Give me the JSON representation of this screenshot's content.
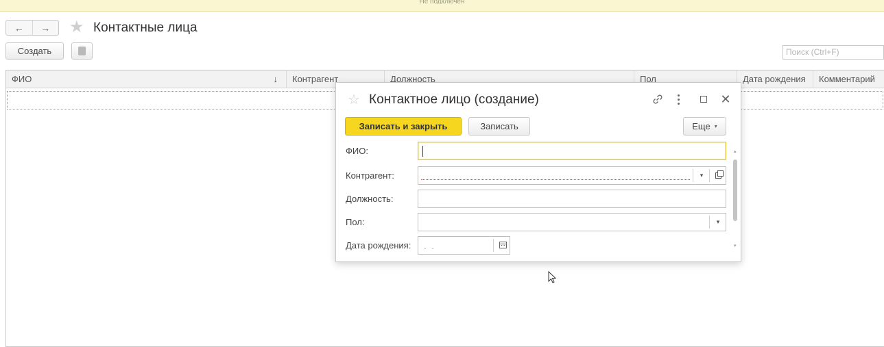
{
  "topbar": {
    "text": "Не подключен"
  },
  "nav": {
    "back_icon": "←",
    "forward_icon": "→"
  },
  "page": {
    "title": "Контактные лица",
    "favorite_icon": "★"
  },
  "toolbar": {
    "create_label": "Создать",
    "print_icon": "print-icon"
  },
  "search": {
    "placeholder": "Поиск (Ctrl+F)"
  },
  "table": {
    "columns": [
      "ФИО",
      "Контрагент",
      "Должность",
      "Пол",
      "Дата рождения",
      "Комментарий"
    ],
    "sort_indicator": "↓"
  },
  "dialog": {
    "title": "Контактное лицо (создание)",
    "star_icon": "☆",
    "close_icon": "✕",
    "buttons": {
      "save_close": "Записать и закрыть",
      "save": "Записать",
      "more": "Еще",
      "more_caret": "▾"
    },
    "fields": {
      "fio": {
        "label": "ФИО:",
        "value": ""
      },
      "kontragent": {
        "label": "Контрагент:",
        "value": "",
        "dropdown": "▾"
      },
      "dolzhnost": {
        "label": "Должность:",
        "value": ""
      },
      "pol": {
        "label": "Пол:",
        "value": "",
        "dropdown": "▾"
      },
      "data_rozhdeniya": {
        "label": "Дата рождения:",
        "mask": ". ."
      }
    },
    "scroll": {
      "up": "▴",
      "down": "▾"
    }
  },
  "colors": {
    "primary_button": "#f6d61e",
    "focus_border": "#e5c43f",
    "header_bg": "#f2f2f2",
    "info_bar": "#fbf6d2"
  }
}
